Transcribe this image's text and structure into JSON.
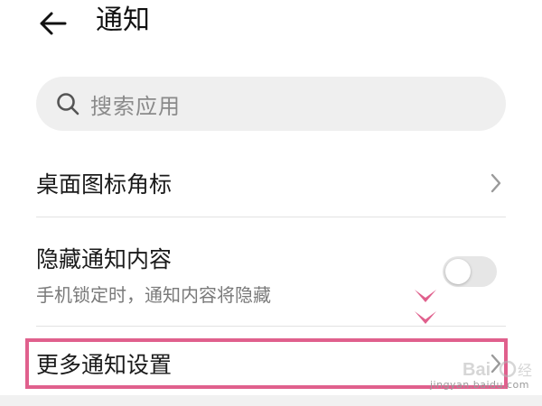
{
  "header": {
    "title": "通知",
    "back_icon": "arrow-left-icon"
  },
  "search": {
    "placeholder": "搜索应用",
    "icon": "search-icon"
  },
  "settings": [
    {
      "label": "桌面图标角标",
      "control": "chevron"
    },
    {
      "label": "隐藏通知内容",
      "sublabel": "手机锁定时，通知内容将隐藏",
      "control": "toggle",
      "toggle_on": false
    },
    {
      "label": "更多通知设置",
      "control": "chevron",
      "highlighted": true
    }
  ],
  "annotation": {
    "highlight_color": "#e0608d",
    "arrow_icon": "double-chevron-down-icon"
  },
  "watermark": {
    "logo": "Baidu 经验",
    "domain": "jingyan.baidu.com"
  },
  "colors": {
    "search_bg": "#efefef",
    "divider": "#e2e2e2",
    "toggle_off": "#e6e6e6",
    "highlight": "#e0608d"
  }
}
